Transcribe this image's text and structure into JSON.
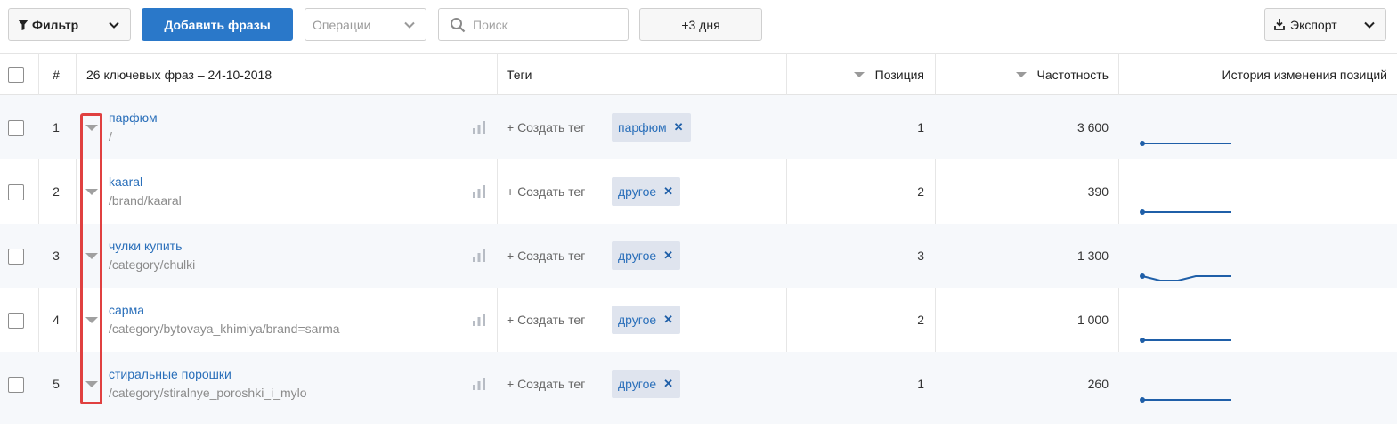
{
  "toolbar": {
    "filter_label": "Фильтр",
    "add_phrases_label": "Добавить фразы",
    "operations_placeholder": "Операции",
    "search_placeholder": "Поиск",
    "days_label": "+3 дня",
    "export_label": "Экспорт"
  },
  "table": {
    "headers": {
      "num": "#",
      "phrases": "26 ключевых фраз – 24-10-2018",
      "tags": "Теги",
      "position": "Позиция",
      "frequency": "Частотность",
      "history": "История изменения позиций"
    },
    "create_tag_label": "+ Создать тег",
    "rows": [
      {
        "num": "1",
        "phrase": "парфюм",
        "url": "/",
        "tag": "парфюм",
        "position": "1",
        "frequency": "3 600",
        "history": [
          1,
          1,
          1,
          1,
          1,
          1
        ]
      },
      {
        "num": "2",
        "phrase": "kaaral",
        "url": "/brand/kaaral",
        "tag": "другое",
        "position": "2",
        "frequency": "390",
        "history": [
          2,
          2,
          2,
          2,
          2,
          2
        ]
      },
      {
        "num": "3",
        "phrase": "чулки купить",
        "url": "/category/chulki",
        "tag": "другое",
        "position": "3",
        "frequency": "1 300",
        "history": [
          2,
          3,
          3,
          2,
          2,
          2
        ]
      },
      {
        "num": "4",
        "phrase": "сарма",
        "url": "/category/bytovaya_khimiya/brand=sarma",
        "tag": "другое",
        "position": "2",
        "frequency": "1 000",
        "history": [
          2,
          2,
          2,
          2,
          2,
          2
        ]
      },
      {
        "num": "5",
        "phrase": "стиральные порошки",
        "url": "/category/stiralnye_poroshki_i_mylo",
        "tag": "другое",
        "position": "1",
        "frequency": "260",
        "history": [
          1,
          1,
          1,
          1,
          1,
          1
        ]
      }
    ]
  },
  "colors": {
    "accent": "#2a78c9",
    "link": "#2a6fba",
    "highlight": "#e04040",
    "sparkline": "#1f5fa8"
  }
}
